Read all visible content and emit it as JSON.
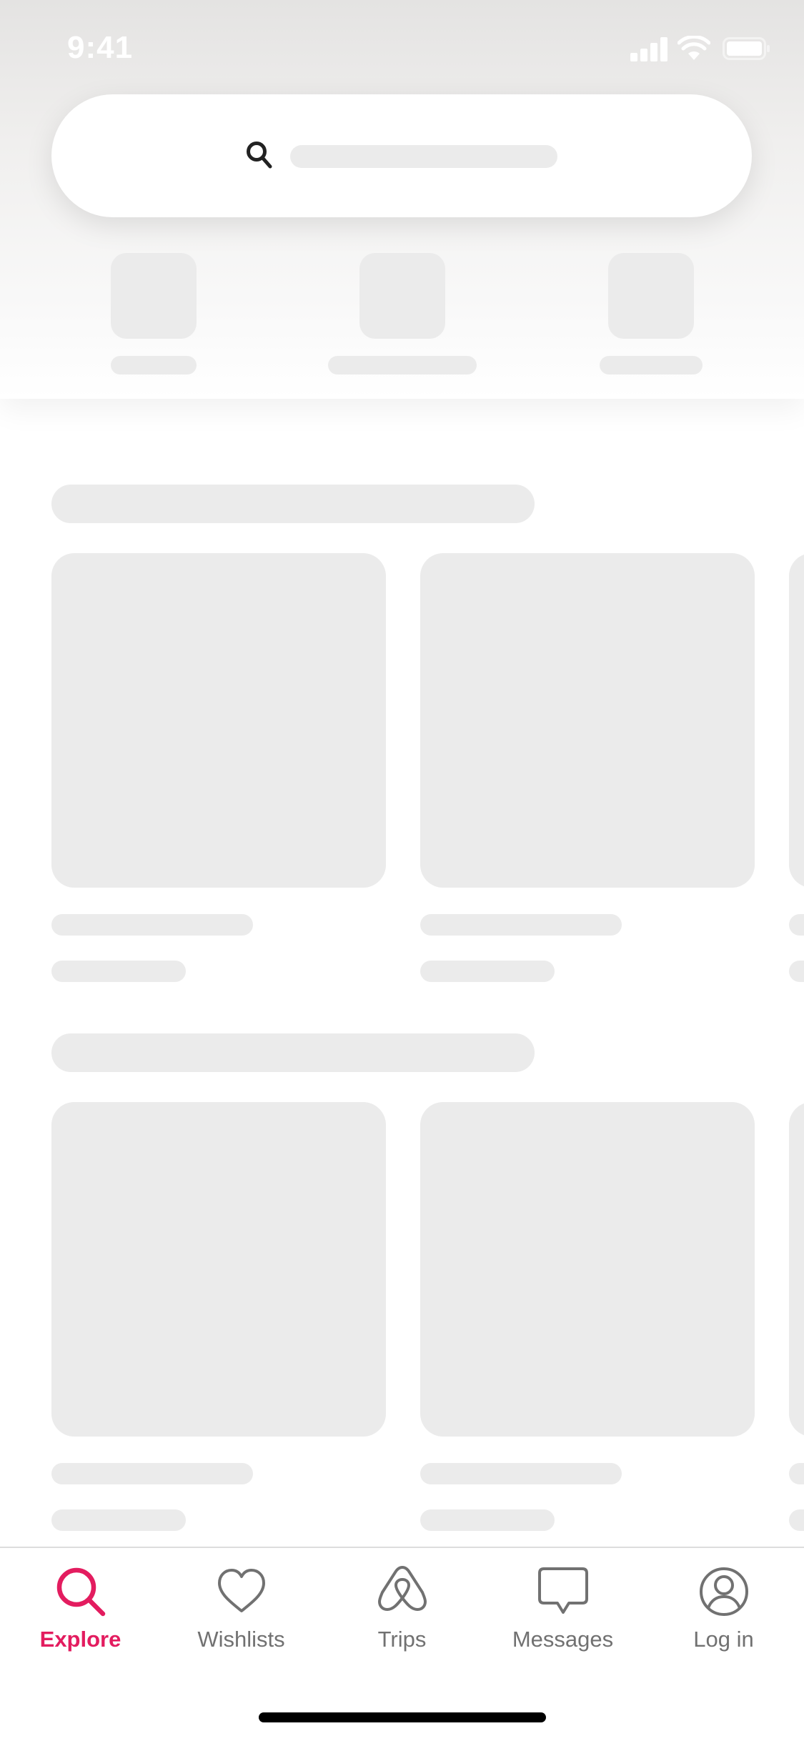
{
  "status_bar": {
    "time": "9:41"
  },
  "search": {
    "icon": "search-icon"
  },
  "tab_bar": {
    "accent_color": "#e31c5f",
    "inactive_color": "#717171",
    "active_tab": "explore",
    "tabs": [
      {
        "id": "explore",
        "label": "Explore",
        "icon": "search-icon"
      },
      {
        "id": "wishlists",
        "label": "Wishlists",
        "icon": "heart-icon"
      },
      {
        "id": "trips",
        "label": "Trips",
        "icon": "airbnb-logo-icon"
      },
      {
        "id": "messages",
        "label": "Messages",
        "icon": "chat-bubble-icon"
      },
      {
        "id": "login",
        "label": "Log in",
        "icon": "user-circle-icon"
      }
    ]
  },
  "colors": {
    "skeleton": "#ebebeb",
    "background": "#ffffff"
  }
}
